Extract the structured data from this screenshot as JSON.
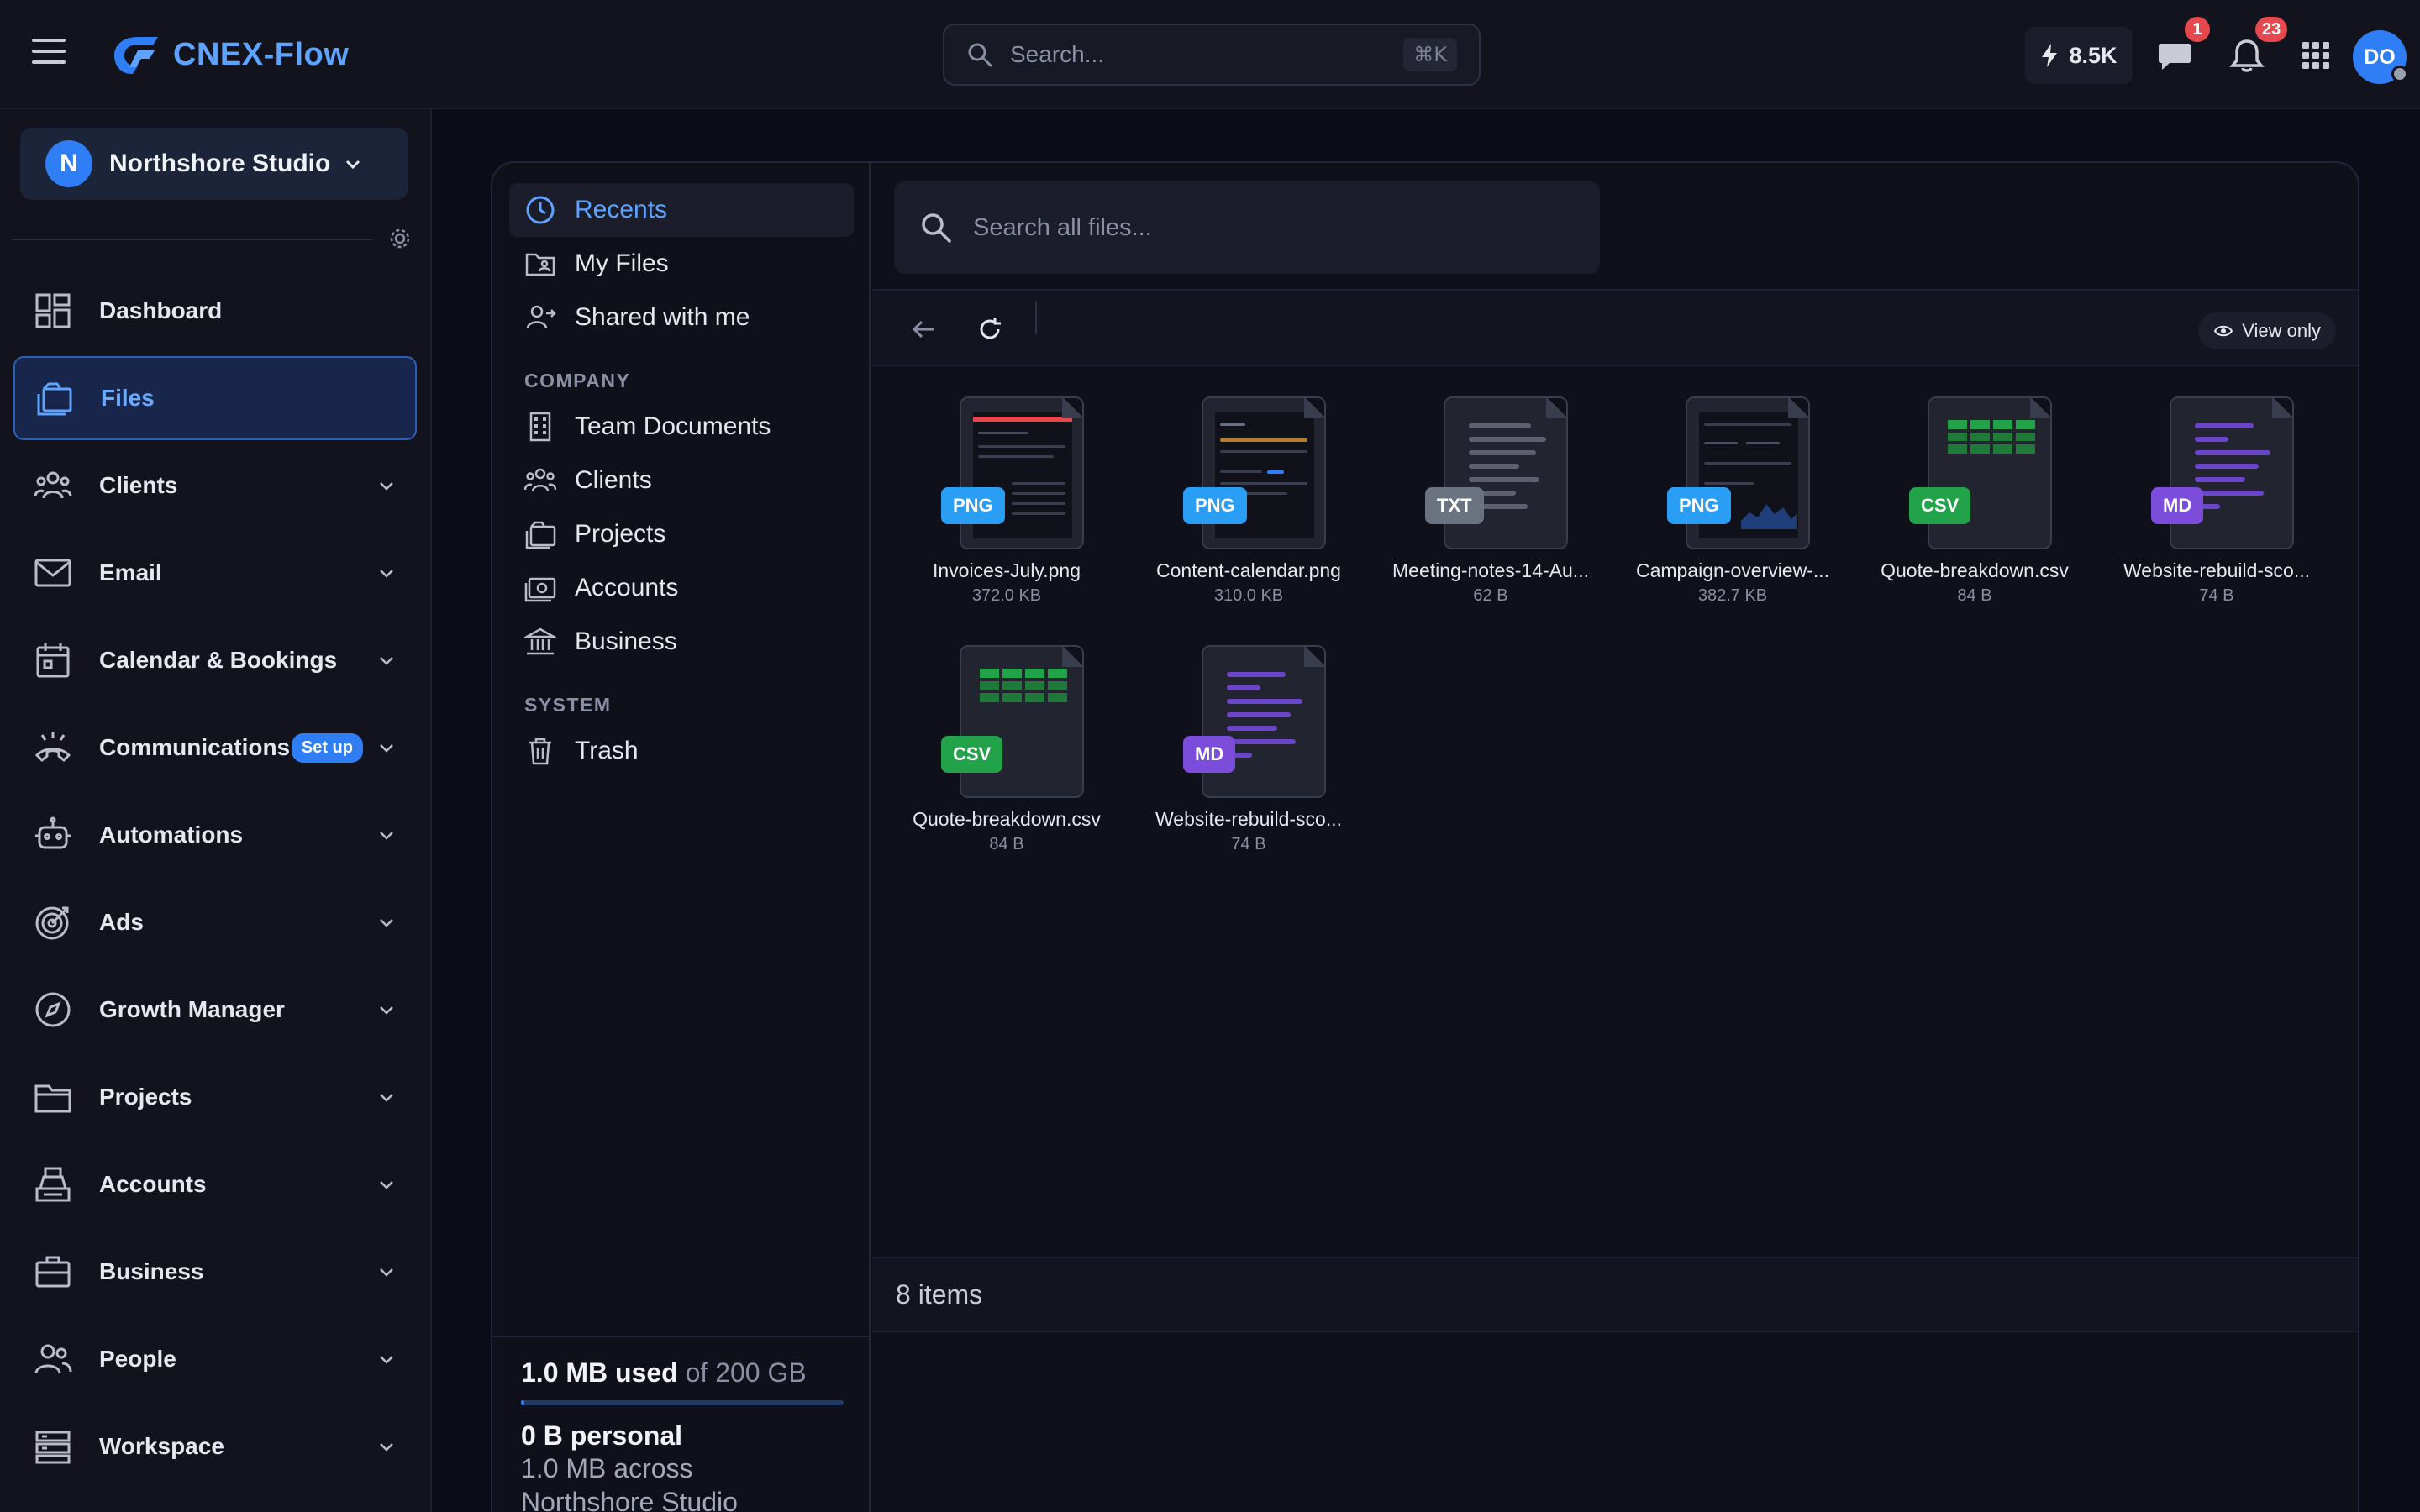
{
  "app": {
    "name": "CNEX-Flow"
  },
  "topbar": {
    "search_placeholder": "Search...",
    "search_shortcut": "⌘K",
    "credits": "8.5K",
    "messages_count": "1",
    "notifications_count": "23",
    "user_initials": "DO"
  },
  "sidebar": {
    "org_name": "Northshore Studio",
    "org_initial": "N",
    "items": [
      {
        "label": "Dashboard",
        "icon": "dashboard-icon"
      },
      {
        "label": "Files",
        "icon": "files-icon",
        "active": true
      },
      {
        "label": "Clients",
        "icon": "clients-icon"
      },
      {
        "label": "Email",
        "icon": "email-icon"
      },
      {
        "label": "Calendar & Bookings",
        "icon": "calendar-icon"
      },
      {
        "label": "Communications",
        "icon": "phone-icon",
        "badge": "Set up"
      },
      {
        "label": "Automations",
        "icon": "robot-icon"
      },
      {
        "label": "Ads",
        "icon": "target-icon"
      },
      {
        "label": "Growth Manager",
        "icon": "compass-icon"
      },
      {
        "label": "Projects",
        "icon": "folder-icon"
      },
      {
        "label": "Accounts",
        "icon": "register-icon"
      },
      {
        "label": "Business",
        "icon": "briefcase-icon"
      },
      {
        "label": "People",
        "icon": "people-icon"
      },
      {
        "label": "Workspace",
        "icon": "server-icon"
      }
    ]
  },
  "filenav": {
    "recents": "Recents",
    "my_files": "My Files",
    "shared": "Shared with me",
    "company_header": "COMPANY",
    "team_documents": "Team Documents",
    "clients": "Clients",
    "projects": "Projects",
    "accounts": "Accounts",
    "business": "Business",
    "system_header": "SYSTEM",
    "trash": "Trash"
  },
  "storage": {
    "used": "1.0 MB used",
    "of": " of 200 GB",
    "used_fraction": 5e-06,
    "personal": "0 B personal",
    "across_line1": "1.0 MB across",
    "across_line2": "Northshore Studio"
  },
  "content": {
    "search_placeholder": "Search all files...",
    "view_only": "View only",
    "item_count": "8 items",
    "files": [
      {
        "name": "Invoices-July.png",
        "size": "372.0 KB",
        "type": "PNG"
      },
      {
        "name": "Content-calendar.png",
        "size": "310.0 KB",
        "type": "PNG"
      },
      {
        "name": "Meeting-notes-14-Au...",
        "size": "62 B",
        "type": "TXT"
      },
      {
        "name": "Campaign-overview-...",
        "size": "382.7 KB",
        "type": "PNG"
      },
      {
        "name": "Quote-breakdown.csv",
        "size": "84 B",
        "type": "CSV"
      },
      {
        "name": "Website-rebuild-sco...",
        "size": "74 B",
        "type": "MD"
      },
      {
        "name": "Quote-breakdown.csv",
        "size": "84 B",
        "type": "CSV"
      },
      {
        "name": "Website-rebuild-sco...",
        "size": "74 B",
        "type": "MD"
      }
    ]
  },
  "colors": {
    "accent": "#2f7ef5",
    "png_badge": "#2a9df4",
    "txt_badge": "#6b7280",
    "csv_badge": "#22a34a",
    "md_badge": "#7c4ddb",
    "alert": "#e5484d"
  }
}
